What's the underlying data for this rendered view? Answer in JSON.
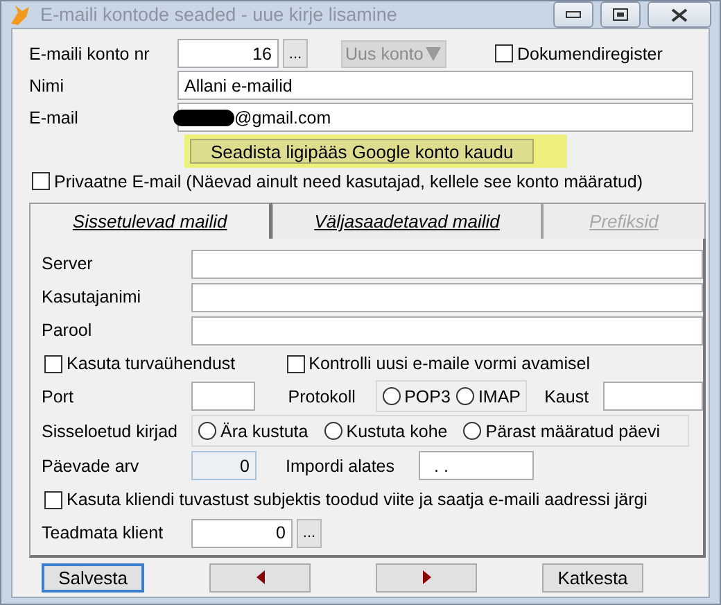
{
  "window": {
    "title": "E-maili kontode seaded - uue kirje lisamine"
  },
  "account": {
    "label": "E-maili konto nr",
    "value": "16",
    "browse": "...",
    "new_account": {
      "label": "Uus konto",
      "disabled": true
    },
    "register": {
      "label": "Dokumendiregister",
      "checked": false
    }
  },
  "name": {
    "label": "Nimi",
    "value": "Allani e-mailid"
  },
  "email": {
    "label": "E-mail",
    "value": "@gmail.com",
    "redacted": true
  },
  "google_button": {
    "label": "Seadista ligipääs Google konto kaudu",
    "highlighted": true
  },
  "private": {
    "label": "Privaatne E-mail (Näevad ainult need kasutajad, kellele see konto määratud)",
    "checked": false
  },
  "tabs": [
    {
      "label": "Sissetulevad mailid",
      "selected": true,
      "disabled": false
    },
    {
      "label": "Väljasaadetavad mailid",
      "selected": false,
      "disabled": false
    },
    {
      "label": "Prefiksid",
      "selected": false,
      "disabled": true
    }
  ],
  "incoming": {
    "fields": [
      {
        "label": "Server"
      },
      {
        "label": "Kasutajanimi"
      },
      {
        "label": "Parool"
      }
    ],
    "secure": {
      "label": "Kasuta turvaühendust",
      "checked": false
    },
    "check_new": {
      "label": "Kontrolli uusi e-maile vormi avamisel",
      "checked": false
    },
    "port": {
      "label": "Port"
    },
    "protocol": {
      "label": "Protokoll",
      "options": [
        {
          "label": "POP3",
          "selected": false
        },
        {
          "label": "IMAP",
          "selected": false
        }
      ]
    },
    "folder": {
      "label": "Kaust"
    },
    "read_records": {
      "label": "Sisseloetud kirjad",
      "options": [
        {
          "label": "Ära kustuta",
          "selected": false
        },
        {
          "label": "Kustuta kohe",
          "selected": false
        },
        {
          "label": "Pärast määratud päevi",
          "selected": false
        }
      ]
    },
    "days": {
      "label": "Päevade arv",
      "value": "0",
      "disabled": true
    },
    "import_from": {
      "label": "Impordi alates",
      "value": ". ."
    },
    "client_id": {
      "label": "Kasuta kliendi tuvastust subjektis toodud viite ja saatja e-maili aadressi järgi",
      "checked": false
    },
    "unknown_client": {
      "label": "Teadmata klient",
      "value": "0",
      "browse": "..."
    }
  },
  "buttons": [
    {
      "kind": "text",
      "label": "Salvesta",
      "focused": true
    },
    {
      "kind": "prev",
      "focused": false
    },
    {
      "kind": "next",
      "focused": false
    },
    {
      "kind": "text",
      "label": "Katkesta",
      "focused": false
    }
  ]
}
